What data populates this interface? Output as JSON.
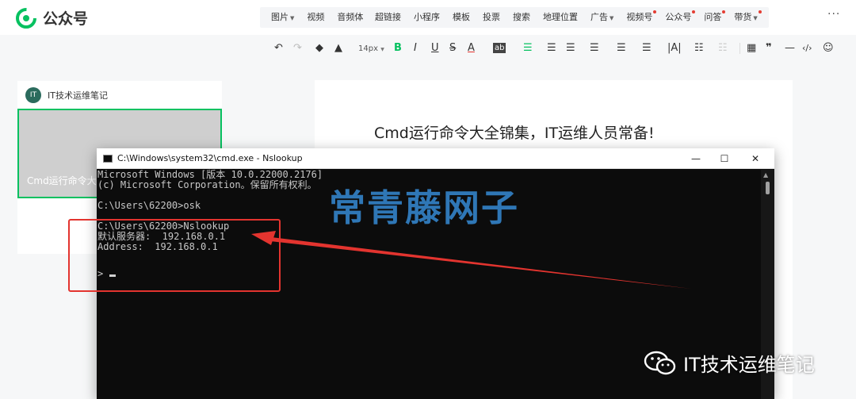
{
  "header": {
    "logo_text": "公众号",
    "menu_a": [
      {
        "label": "图片",
        "caret": true,
        "dot": false
      },
      {
        "label": "视频",
        "caret": false,
        "dot": false
      },
      {
        "label": "音频体",
        "caret": true,
        "dot": false
      }
    ],
    "menu_b": [
      {
        "label": "超链接",
        "caret": false,
        "dot": false
      },
      {
        "label": "小程序",
        "caret": false,
        "dot": false
      },
      {
        "label": "模板",
        "caret": false,
        "dot": false
      },
      {
        "label": "投票",
        "caret": false,
        "dot": false
      },
      {
        "label": "搜索",
        "caret": false,
        "dot": false
      },
      {
        "label": "地理位置",
        "caret": false,
        "dot": false
      },
      {
        "label": "广告",
        "caret": true,
        "dot": false
      },
      {
        "label": "视频号",
        "caret": false,
        "dot": true
      },
      {
        "label": "公众号",
        "caret": false,
        "dot": true
      },
      {
        "label": "问答",
        "caret": false,
        "dot": true
      },
      {
        "label": "带货",
        "caret": true,
        "dot": true
      }
    ],
    "more_label": "···"
  },
  "toolbar": {
    "undo_label": "↶",
    "redo_label": "↷",
    "font_size": "14px",
    "bold": "B",
    "italic": "I",
    "underline": "U",
    "strike": "S",
    "font_color": "A",
    "bg_color": "ab",
    "quote": "❞",
    "hr": "—",
    "code": "‹/›"
  },
  "left_panel": {
    "account_name": "IT技术运维笔记",
    "thumb_title": "Cmd运行命令大全锦集，IT运维人员常备！"
  },
  "editor": {
    "title": "Cmd运行命令大全锦集，IT运维人员常备!"
  },
  "cmd": {
    "window_title": "C:\\Windows\\system32\\cmd.exe - Nslookup",
    "minimize": "—",
    "maximize": "☐",
    "close": "✕",
    "lines": [
      "Microsoft Windows [版本 10.0.22000.2176]",
      "(c) Microsoft Corporation。保留所有权利。",
      "",
      "C:\\Users\\62200>osk",
      "",
      "C:\\Users\\62200>Nslookup",
      "默认服务器:  192.168.0.1",
      "Address:  192.168.0.1",
      "",
      ">"
    ]
  },
  "overlay": {
    "watermark": "常青藤网子",
    "brand_text": "IT技术运维笔记"
  },
  "colors": {
    "accent": "#07c160",
    "highlight": "#e3342f",
    "watermark": "#2f77b6"
  }
}
